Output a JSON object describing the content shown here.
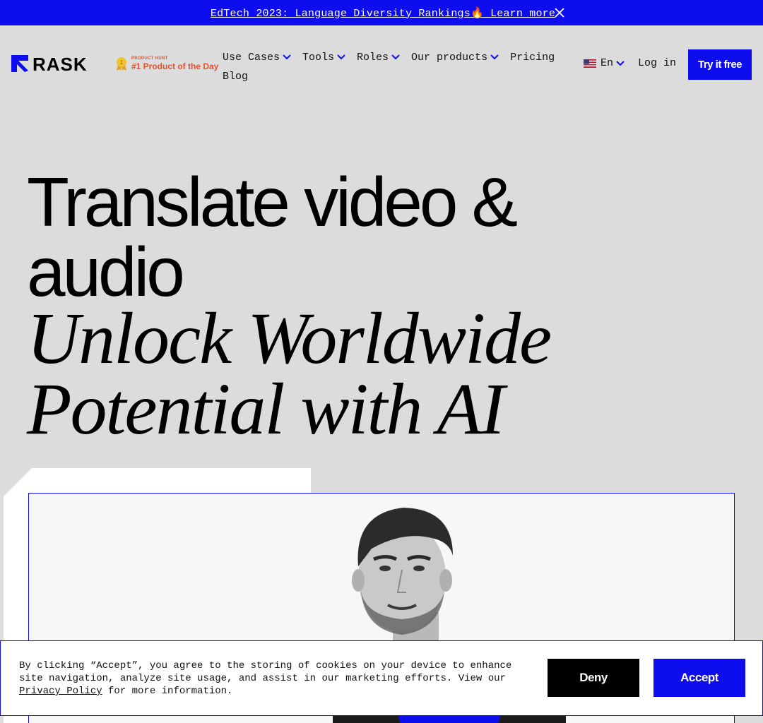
{
  "banner": {
    "text": "EdTech 2023: Language Diversity Rankings",
    "emoji": "🔥",
    "link": "Learn more",
    "close_icon": "close-icon"
  },
  "header": {
    "logo_text": "RASK",
    "badge": {
      "small": "PRODUCT HUNT",
      "big": "#1 Product of the Day",
      "icon": "medal-icon"
    },
    "nav": [
      {
        "label": "Use Cases",
        "dropdown": true
      },
      {
        "label": "Tools",
        "dropdown": true
      },
      {
        "label": "Roles",
        "dropdown": true
      },
      {
        "label": "Our products",
        "dropdown": true
      },
      {
        "label": "Pricing",
        "dropdown": false
      },
      {
        "label": "Blog",
        "dropdown": false
      }
    ],
    "language": {
      "flag": "us-flag-icon",
      "label": "En"
    },
    "login": "Log in",
    "cta": "Try it free"
  },
  "hero": {
    "line1": "Translate video &",
    "line2": "audio",
    "italic1": "Unlock Worldwide",
    "italic2": "Potential with AI"
  },
  "cookie": {
    "text_before": "By clicking “Accept”, you agree to the storing of cookies on your device to enhance site navigation, analyze site usage, and assist in our marketing efforts. View our ",
    "link": "Privacy Policy",
    "text_after": " for more information.",
    "deny": "Deny",
    "accept": "Accept"
  },
  "colors": {
    "brand": "#0d0ded",
    "background": "#dcdcdc",
    "badge": "#e0542e"
  }
}
